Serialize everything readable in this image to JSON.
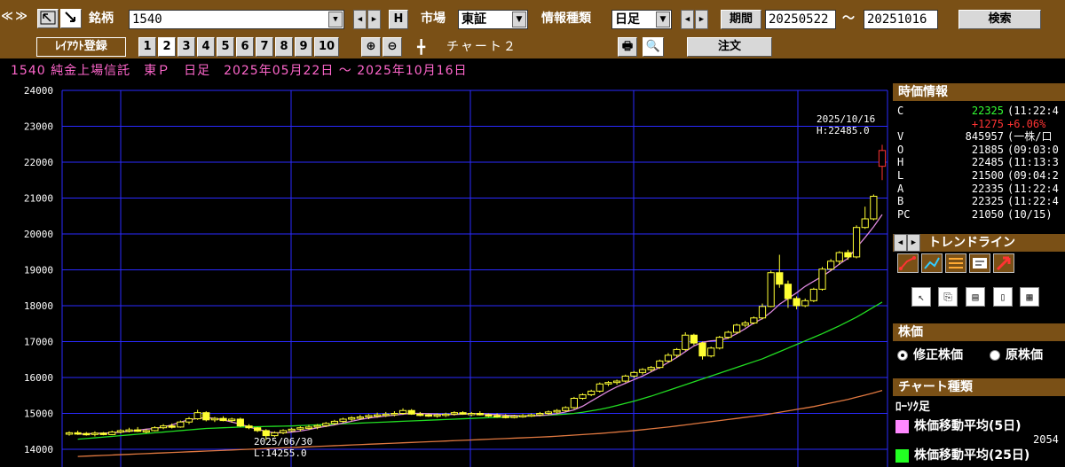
{
  "toolbar1": {
    "nav_prev": "≪",
    "nav_next": "≫",
    "symbol_label": "銘柄",
    "symbol_value": "1540",
    "symbol_letter": "H",
    "market_label": "市場",
    "market_value": "東証",
    "info_label": "情報種類",
    "info_value": "日足",
    "period_label": "期間",
    "start_date": "20250522",
    "range_sep": "～",
    "end_date": "20251016",
    "search_label": "検索"
  },
  "toolbar2": {
    "layout_save": "ﾚｲｱｳﾄ登録",
    "layout_nums": [
      "1",
      "2",
      "3",
      "4",
      "5",
      "6",
      "7",
      "8",
      "9",
      "10"
    ],
    "chart_name": "チャート２",
    "order_label": "注文"
  },
  "chart_title": "1540 純金上場信託　東Ｐ　日足　2025年05月22日 ～ 2025年10月16日",
  "quote": {
    "header": "時価情報",
    "rows": [
      {
        "k": "C",
        "v": "22325",
        "t": "(11:22:4",
        "color": "#33ff33"
      },
      {
        "k": "",
        "v": "+1275",
        "t": "+6.06%",
        "color": "#ff3333"
      },
      {
        "k": "V",
        "v": "845957",
        "t": "(一株/口",
        "color": "#ffffff"
      },
      {
        "k": "O",
        "v": "21885",
        "t": "(09:03:0",
        "color": "#ffffff"
      },
      {
        "k": "H",
        "v": "22485",
        "t": "(11:13:3",
        "color": "#ffffff"
      },
      {
        "k": "L",
        "v": "21500",
        "t": "(09:04:2",
        "color": "#ffffff"
      },
      {
        "k": "A",
        "v": "22335",
        "t": "(11:22:4",
        "color": "#ffffff"
      },
      {
        "k": "B",
        "v": "22325",
        "t": "(11:22:4",
        "color": "#ffffff"
      },
      {
        "k": "PC",
        "v": "21050",
        "t": "(10/15)",
        "color": "#ffffff"
      }
    ]
  },
  "trendline_header": "トレンドライン",
  "price_header": "株価",
  "price_options": [
    "修正株価",
    "原株価"
  ],
  "chart_type_header": "チャート種類",
  "chart_type_value": "ﾛｰｿｸ足",
  "ma_legend": [
    {
      "label": "株価移動平均(5日)",
      "color": "#ff88ff",
      "value": "2054"
    },
    {
      "label": "株価移動平均(25日)",
      "color": "#22ff22",
      "value": ""
    }
  ],
  "chart_data": {
    "type": "candlestick",
    "title": "1540 純金上場信託　東Ｐ　日足　2025年05月22日 ～ 2025年10月16日",
    "y_ticks": [
      14000,
      15000,
      16000,
      17000,
      18000,
      19000,
      20000,
      21000,
      22000,
      23000,
      24000
    ],
    "ylim": [
      13700,
      24000
    ],
    "grid": true,
    "annotations": [
      {
        "date": "2025/06/30",
        "text_top": "2025/06/30",
        "text_bottom": "L:14255.0",
        "value": 14255
      },
      {
        "date": "2025/10/16",
        "text_top": "2025/10/16",
        "text_bottom": "H:22485.0",
        "value": 22485
      }
    ],
    "candles": [
      [
        14420,
        14500,
        14380,
        14460
      ],
      [
        14460,
        14520,
        14400,
        14440
      ],
      [
        14440,
        14480,
        14380,
        14420
      ],
      [
        14420,
        14500,
        14360,
        14450
      ],
      [
        14450,
        14480,
        14390,
        14410
      ],
      [
        14410,
        14520,
        14400,
        14480
      ],
      [
        14480,
        14560,
        14440,
        14520
      ],
      [
        14520,
        14600,
        14470,
        14540
      ],
      [
        14540,
        14620,
        14480,
        14500
      ],
      [
        14500,
        14560,
        14450,
        14520
      ],
      [
        14520,
        14640,
        14500,
        14600
      ],
      [
        14600,
        14700,
        14560,
        14650
      ],
      [
        14650,
        14720,
        14580,
        14620
      ],
      [
        14620,
        14800,
        14600,
        14760
      ],
      [
        14760,
        14900,
        14700,
        14850
      ],
      [
        14850,
        15100,
        14820,
        15020
      ],
      [
        15020,
        15060,
        14780,
        14820
      ],
      [
        14820,
        14900,
        14760,
        14860
      ],
      [
        14860,
        14920,
        14780,
        14800
      ],
      [
        14800,
        14880,
        14740,
        14840
      ],
      [
        14840,
        14880,
        14620,
        14650
      ],
      [
        14650,
        14700,
        14560,
        14600
      ],
      [
        14600,
        14620,
        14480,
        14520
      ],
      [
        14520,
        14560,
        14255,
        14380
      ],
      [
        14380,
        14500,
        14340,
        14460
      ],
      [
        14460,
        14560,
        14420,
        14520
      ],
      [
        14520,
        14600,
        14480,
        14560
      ],
      [
        14560,
        14640,
        14500,
        14600
      ],
      [
        14600,
        14680,
        14540,
        14620
      ],
      [
        14620,
        14700,
        14560,
        14660
      ],
      [
        14660,
        14760,
        14620,
        14720
      ],
      [
        14720,
        14820,
        14680,
        14780
      ],
      [
        14780,
        14880,
        14740,
        14840
      ],
      [
        14840,
        14920,
        14780,
        14880
      ],
      [
        14880,
        14960,
        14820,
        14900
      ],
      [
        14900,
        14980,
        14840,
        14940
      ],
      [
        14940,
        15020,
        14880,
        14960
      ],
      [
        14960,
        15040,
        14900,
        14980
      ],
      [
        14980,
        15060,
        14920,
        15000
      ],
      [
        15000,
        15140,
        14960,
        15080
      ],
      [
        15080,
        15120,
        14960,
        14980
      ],
      [
        14980,
        15040,
        14920,
        14960
      ],
      [
        14960,
        15000,
        14900,
        14940
      ],
      [
        14940,
        15000,
        14880,
        14960
      ],
      [
        14960,
        15020,
        14900,
        14980
      ],
      [
        14980,
        15060,
        14940,
        15020
      ],
      [
        15020,
        15060,
        14960,
        14980
      ],
      [
        14980,
        15040,
        14920,
        15000
      ],
      [
        15000,
        15060,
        14940,
        14960
      ],
      [
        14960,
        15000,
        14900,
        14940
      ],
      [
        14940,
        15000,
        14880,
        14920
      ],
      [
        14920,
        14980,
        14860,
        14900
      ],
      [
        14900,
        14960,
        14860,
        14920
      ],
      [
        14920,
        14980,
        14880,
        14940
      ],
      [
        14940,
        15000,
        14900,
        14960
      ],
      [
        14960,
        15040,
        14920,
        15000
      ],
      [
        15000,
        15080,
        14960,
        15040
      ],
      [
        15040,
        15120,
        15000,
        15080
      ],
      [
        15080,
        15200,
        15040,
        15160
      ],
      [
        15160,
        15460,
        15120,
        15420
      ],
      [
        15420,
        15560,
        15380,
        15520
      ],
      [
        15520,
        15660,
        15480,
        15620
      ],
      [
        15620,
        15860,
        15580,
        15820
      ],
      [
        15820,
        15900,
        15760,
        15860
      ],
      [
        15860,
        15940,
        15800,
        15900
      ],
      [
        15900,
        16080,
        15860,
        16040
      ],
      [
        16040,
        16180,
        15980,
        16140
      ],
      [
        16140,
        16260,
        16080,
        16220
      ],
      [
        16220,
        16320,
        16160,
        16280
      ],
      [
        16280,
        16500,
        16240,
        16460
      ],
      [
        16460,
        16680,
        16420,
        16620
      ],
      [
        16620,
        16820,
        16560,
        16780
      ],
      [
        16780,
        17260,
        16740,
        17180
      ],
      [
        17180,
        17220,
        16900,
        16960
      ],
      [
        16960,
        17000,
        16500,
        16600
      ],
      [
        16600,
        16860,
        16560,
        16820
      ],
      [
        16820,
        17160,
        16780,
        17120
      ],
      [
        17120,
        17300,
        17080,
        17260
      ],
      [
        17260,
        17500,
        17220,
        17460
      ],
      [
        17460,
        17580,
        17400,
        17520
      ],
      [
        17520,
        17700,
        17480,
        17660
      ],
      [
        17660,
        18060,
        17620,
        17980
      ],
      [
        17980,
        18980,
        17960,
        18920
      ],
      [
        18920,
        19420,
        18500,
        18600
      ],
      [
        18600,
        18700,
        17940,
        18200
      ],
      [
        18200,
        18260,
        17900,
        18000
      ],
      [
        18000,
        18200,
        17960,
        18140
      ],
      [
        18140,
        18500,
        18100,
        18460
      ],
      [
        18460,
        19080,
        18420,
        19020
      ],
      [
        19020,
        19300,
        18980,
        19240
      ],
      [
        19240,
        19520,
        19140,
        19480
      ],
      [
        19480,
        19560,
        19280,
        19360
      ],
      [
        19360,
        20240,
        19320,
        20180
      ],
      [
        20180,
        20760,
        20140,
        20420
      ],
      [
        20420,
        21100,
        20380,
        21050
      ],
      [
        21885,
        22485,
        21500,
        22325
      ]
    ],
    "ma5": [
      14420,
      14430,
      14440,
      14450,
      14460,
      14480,
      14500,
      14530,
      14560,
      14580,
      14620,
      14680,
      14760,
      14820,
      14860,
      14880,
      14860,
      14820,
      14760,
      14700,
      14620,
      14560,
      14500,
      14460,
      14460,
      14480,
      14510,
      14550,
      14600,
      14640,
      14680,
      14730,
      14780,
      14830,
      14870,
      14900,
      14930,
      14950,
      14980,
      15000,
      15000,
      14990,
      14980,
      14970,
      14970,
      14980,
      14990,
      14990,
      14980,
      14970,
      14950,
      14940,
      14930,
      14930,
      14940,
      14960,
      14990,
      15040,
      15100,
      15200,
      15340,
      15480,
      15620,
      15740,
      15840,
      15940,
      16040,
      16160,
      16280,
      16420,
      16560,
      16720,
      16880,
      16980,
      17020,
      17040,
      17100,
      17220,
      17360,
      17520,
      17640,
      17820,
      18040,
      18200,
      18360,
      18540,
      18680,
      18820,
      18980,
      19160,
      19320,
      19620,
      19900,
      20200,
      20540
    ],
    "ma25": [
      14280,
      14300,
      14320,
      14340,
      14360,
      14380,
      14400,
      14420,
      14440,
      14460,
      14480,
      14500,
      14520,
      14540,
      14560,
      14580,
      14590,
      14600,
      14610,
      14620,
      14625,
      14630,
      14635,
      14640,
      14645,
      14650,
      14660,
      14670,
      14680,
      14690,
      14700,
      14710,
      14720,
      14730,
      14740,
      14750,
      14760,
      14770,
      14780,
      14790,
      14800,
      14810,
      14820,
      14830,
      14840,
      14850,
      14860,
      14870,
      14880,
      14890,
      14900,
      14910,
      14920,
      14930,
      14940,
      14950,
      14965,
      14980,
      15000,
      15030,
      15070,
      15110,
      15160,
      15220,
      15280,
      15340,
      15410,
      15480,
      15560,
      15640,
      15720,
      15800,
      15880,
      15960,
      16040,
      16120,
      16200,
      16280,
      16360,
      16440,
      16520,
      16620,
      16720,
      16820,
      16920,
      17020,
      17120,
      17220,
      17330,
      17440,
      17560,
      17680,
      17820,
      17960,
      18100
    ],
    "ma75": [
      13800,
      13810,
      13820,
      13830,
      13840,
      13850,
      13860,
      13870,
      13880,
      13890,
      13900,
      13910,
      13920,
      13930,
      13940,
      13950,
      13960,
      13970,
      13980,
      13990,
      14000,
      14010,
      14020,
      14030,
      14040,
      14050,
      14060,
      14070,
      14080,
      14090,
      14100,
      14110,
      14120,
      14130,
      14140,
      14150,
      14160,
      14170,
      14180,
      14190,
      14200,
      14210,
      14220,
      14230,
      14240,
      14250,
      14260,
      14270,
      14280,
      14290,
      14300,
      14310,
      14320,
      14330,
      14340,
      14350,
      14365,
      14380,
      14395,
      14410,
      14425,
      14440,
      14460,
      14480,
      14500,
      14520,
      14545,
      14570,
      14595,
      14620,
      14650,
      14680,
      14710,
      14740,
      14770,
      14800,
      14830,
      14860,
      14890,
      14920,
      14950,
      14990,
      15030,
      15070,
      15110,
      15150,
      15190,
      15240,
      15290,
      15340,
      15390,
      15450,
      15510,
      15570,
      15640
    ]
  }
}
